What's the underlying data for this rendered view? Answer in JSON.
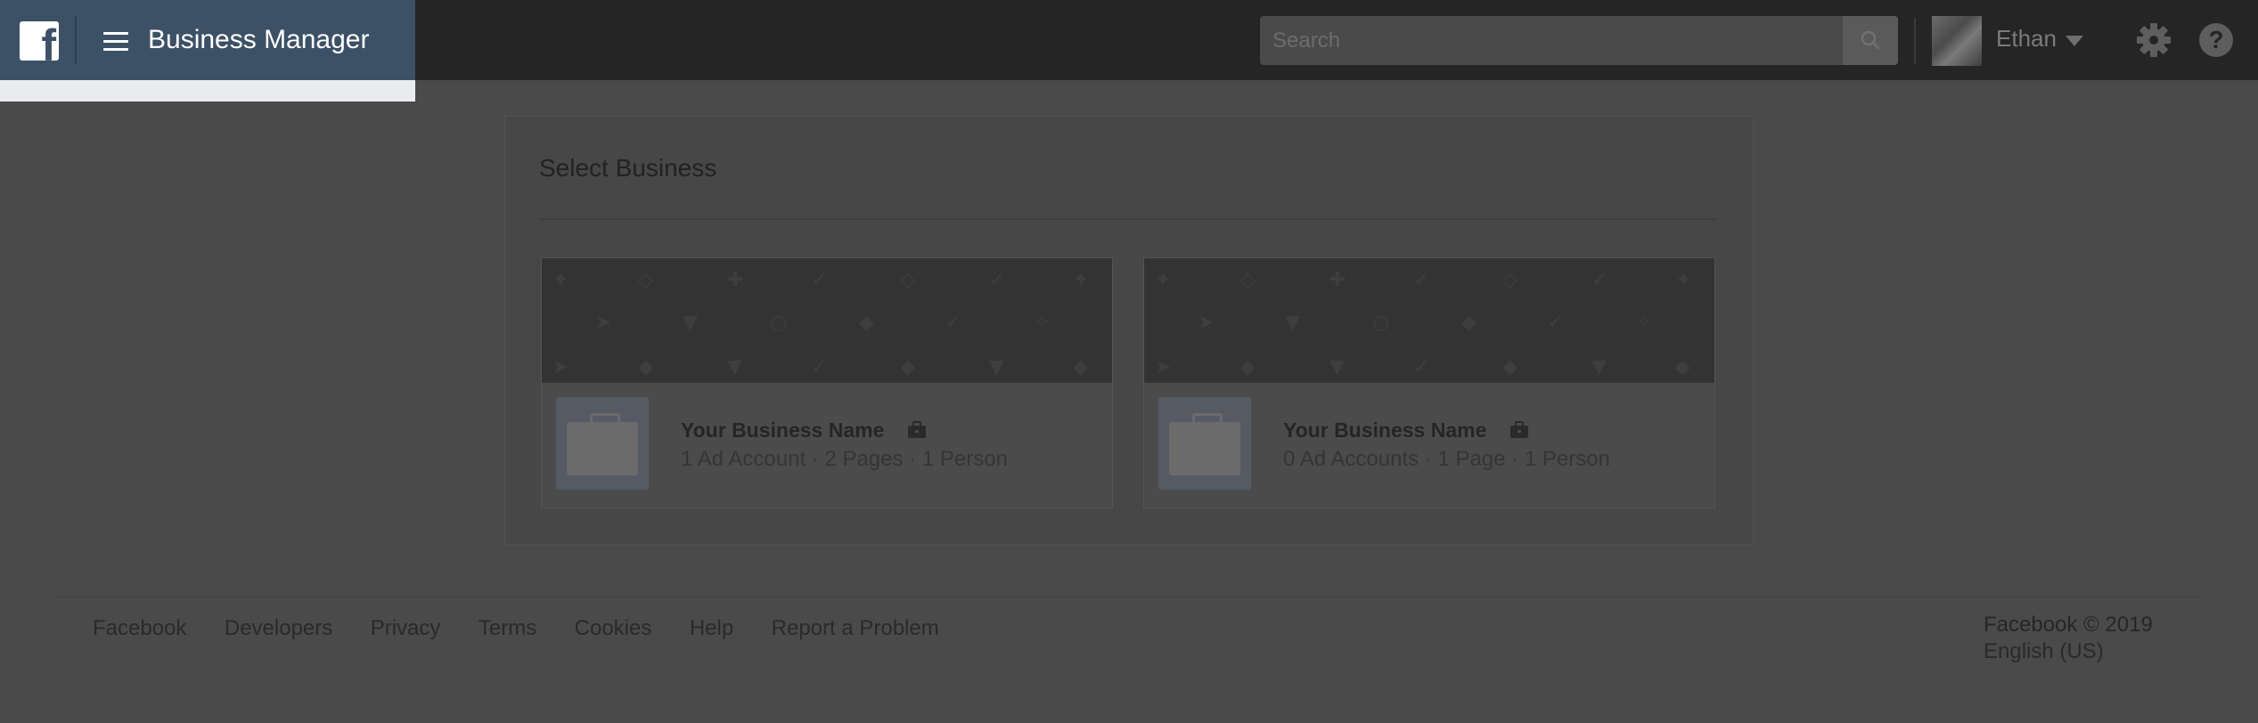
{
  "header": {
    "app_title": "Business Manager",
    "search": {
      "placeholder": "Search",
      "value": ""
    },
    "user": {
      "name": "Ethan"
    }
  },
  "main": {
    "title": "Select Business",
    "businesses": [
      {
        "name": "Your Business Name",
        "stats": "1 Ad Account · 2 Pages · 1 Person"
      },
      {
        "name": "Your Business Name",
        "stats": "0 Ad Accounts · 1 Page · 1 Person"
      }
    ]
  },
  "footer": {
    "links": [
      "Facebook",
      "Developers",
      "Privacy",
      "Terms",
      "Cookies",
      "Help",
      "Report a Problem"
    ],
    "copyright": "Facebook © 2019",
    "language": "English (US)"
  },
  "colors": {
    "brand_header": "#3d5166",
    "overlay": "#4a4a4a",
    "topbar": "#252526"
  },
  "icons": [
    "facebook-logo-icon",
    "hamburger-menu-icon",
    "search-icon",
    "chevron-down-icon",
    "gear-icon",
    "help-icon",
    "briefcase-icon"
  ]
}
